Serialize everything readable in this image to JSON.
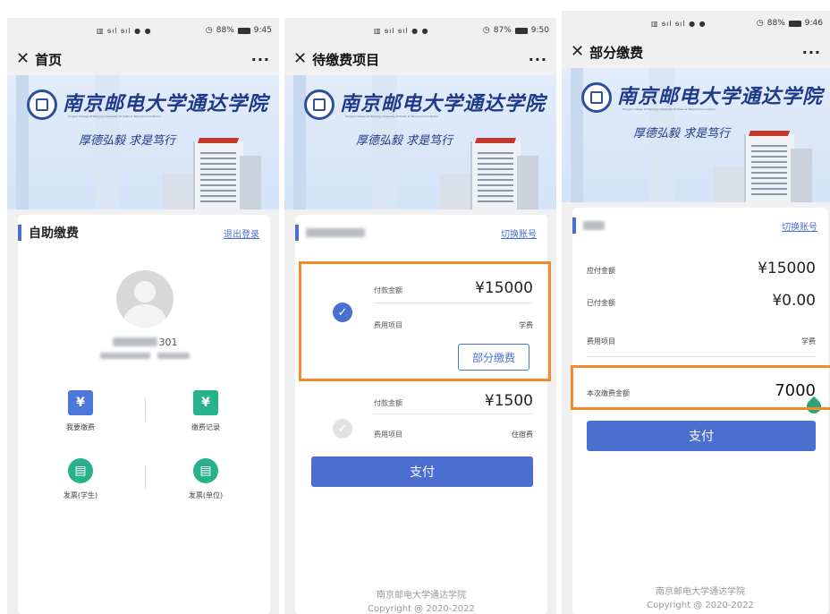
{
  "status": {
    "screen1": {
      "battery": "88%",
      "time": "9:45"
    },
    "screen2": {
      "battery": "87%",
      "time": "9:50"
    },
    "screen3": {
      "battery": "88%",
      "time": "9:46"
    }
  },
  "screen1": {
    "title": "首页",
    "more": "···",
    "card_title": "自助缴费",
    "logout": "退出登录",
    "user_id_partial": "301",
    "features": [
      {
        "label": "我要缴费",
        "icon": "yen-card-icon"
      },
      {
        "label": "缴费记录",
        "icon": "yen-clipboard-icon"
      },
      {
        "label": "发票(学生)",
        "icon": "invoice-icon"
      },
      {
        "label": "发票(单位)",
        "icon": "invoice-icon"
      }
    ]
  },
  "screen2": {
    "title": "待缴费项目",
    "more": "···",
    "switch_account": "切换账号",
    "items": [
      {
        "amount_label": "付款金额",
        "amount": "¥15000",
        "type_label": "费用项目",
        "type": "学费",
        "selected": true,
        "partial_label": "部分缴费"
      },
      {
        "amount_label": "付款金额",
        "amount": "¥1500",
        "type_label": "费用项目",
        "type": "住宿费",
        "selected": false
      }
    ],
    "pay": "支付",
    "footer_org": "南京邮电大学通达学院",
    "footer_copy": "Copyright @ 2020-2022"
  },
  "screen3": {
    "title": "部分缴费",
    "more": "···",
    "switch_account": "切换账号",
    "due_label": "应付金额",
    "due": "¥15000",
    "paid_label": "已付金额",
    "paid": "¥0.00",
    "type_label": "费用项目",
    "type": "学费",
    "this_label": "本次缴费金额",
    "this_value": "7000",
    "pay": "支付",
    "footer_org": "南京邮电大学通达学院",
    "footer_copy": "Copyright @ 2020-2022"
  },
  "banner": {
    "school_name": "南京邮电大学通达学院",
    "school_en": "Tongda College Of Nanjing University Of Posts & Telecommunications",
    "motto": "厚德弘毅 求是笃行"
  },
  "colors": {
    "accent": "#4a6fd1",
    "highlight": "#f08a2b",
    "green": "#28b28c"
  }
}
